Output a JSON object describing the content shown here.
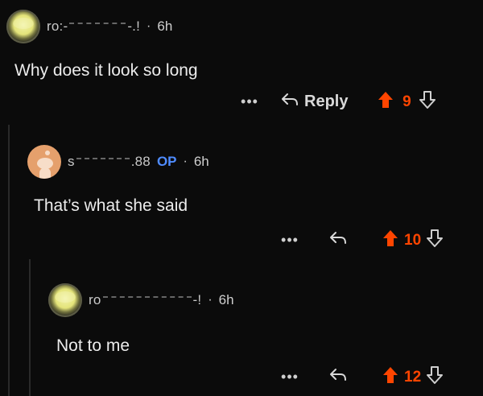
{
  "colors": {
    "background": "#0b0b0b",
    "upvote": "#ff4500",
    "op_badge": "#4f8cff"
  },
  "comments": [
    {
      "avatar": "cooking-pot-avatar",
      "username_start": "ro:-",
      "username_end": "-.!",
      "op": false,
      "dot": "·",
      "time": "6h",
      "text": "Why does it look so long",
      "more_icon": "more-options-icon",
      "reply_label": "Reply",
      "upvotes": "9"
    },
    {
      "avatar": "snoo-avatar",
      "username_start": "s",
      "username_end": ".88",
      "op": true,
      "op_label": "OP",
      "dot": "·",
      "time": "6h",
      "text": "That’s what she said",
      "more_icon": "more-options-icon",
      "reply_label": "",
      "upvotes": "10"
    },
    {
      "avatar": "cooking-pot-avatar",
      "username_start": "ro",
      "username_end": "-!",
      "op": false,
      "dot": "·",
      "time": "6h",
      "text": "Not to me",
      "more_icon": "more-options-icon",
      "reply_label": "",
      "upvotes": "12"
    }
  ]
}
